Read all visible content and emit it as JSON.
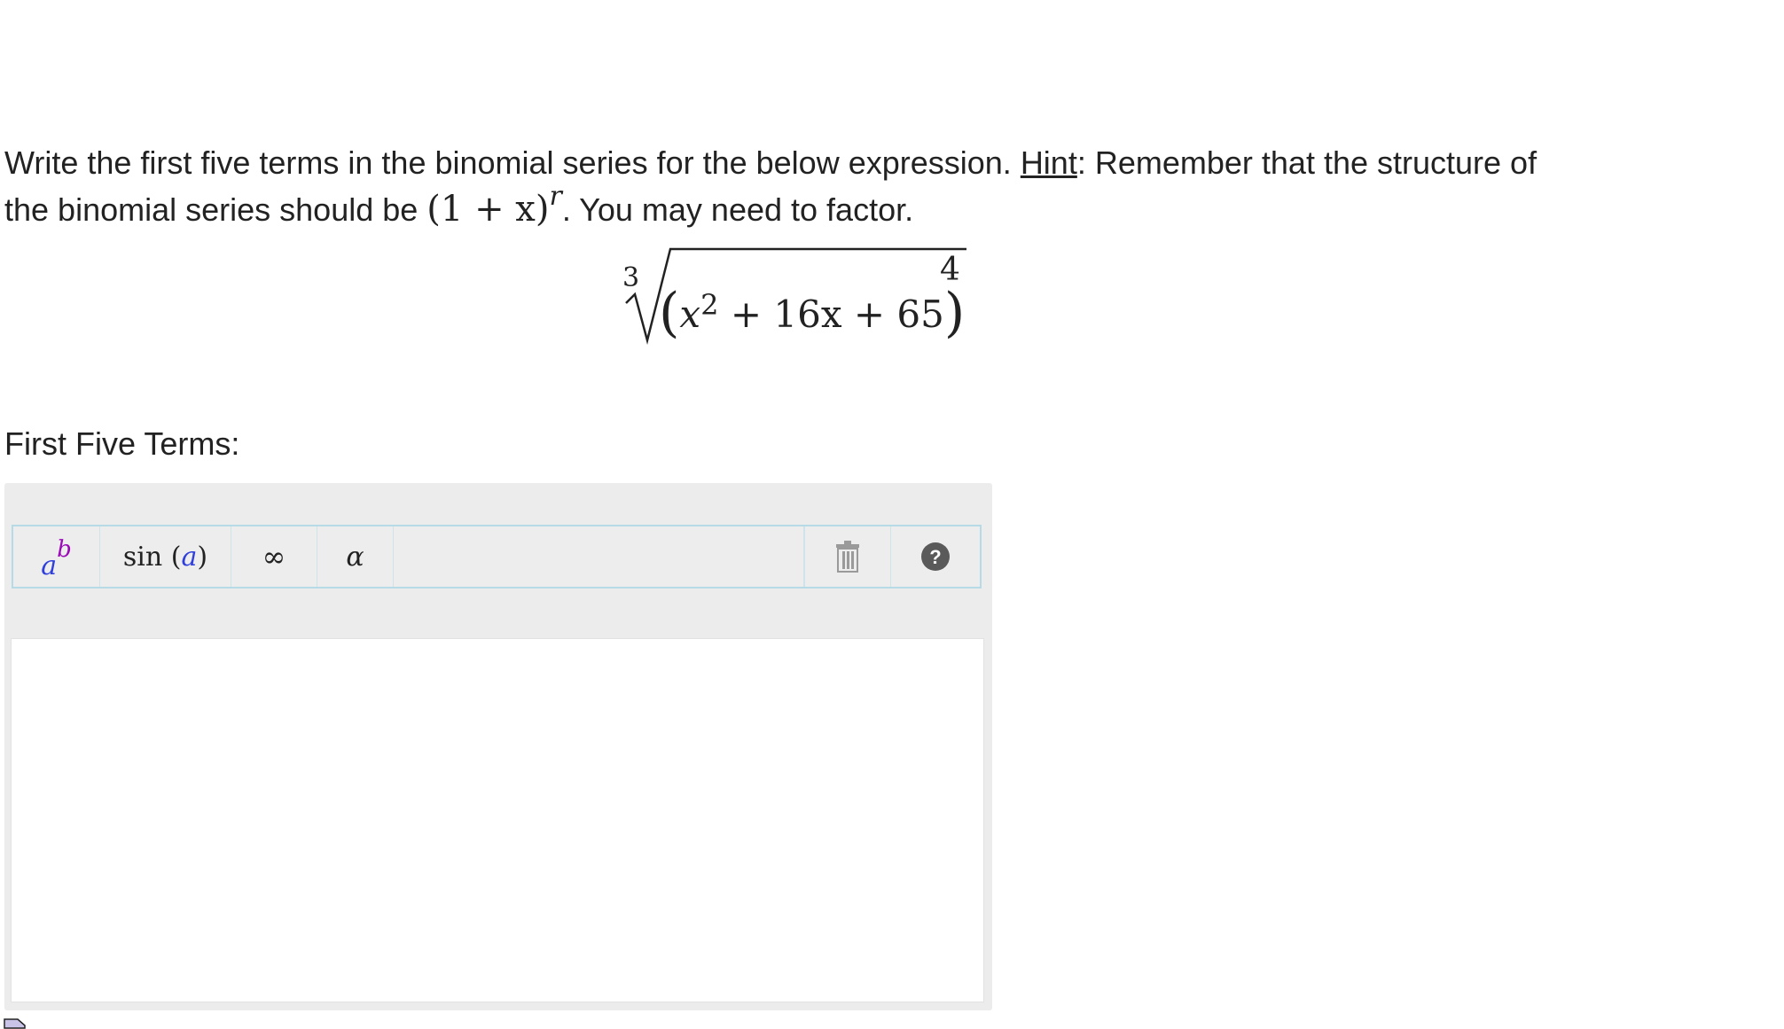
{
  "question": {
    "part1": "Write the first five terms in the binomial series for the below expression.",
    "hint_label": "Hint",
    "part2": ": Remember that the structure of",
    "part3": "the binomial series should be",
    "series_form_base": "(1 + x)",
    "series_form_exp": "r",
    "part4": ". You may need to factor."
  },
  "expression": {
    "root_index": "3",
    "body_x": "x",
    "body_exp": "2",
    "body_rest": "+ 16x + 65",
    "outer_exp": "4"
  },
  "answer": {
    "label": "First Five Terms:",
    "value": ""
  },
  "toolbar": {
    "pow_base": "a",
    "pow_exp": "b",
    "sin_func": "sin",
    "sin_arg": "a",
    "infinity": "∞",
    "alpha": "α",
    "trash_icon": "trash-icon",
    "help_icon": "help-icon"
  },
  "colors": {
    "toolbar_border": "#b6dbe6",
    "variable_blue": "#2e3fdb",
    "exponent_purple": "#9b0ab8"
  }
}
